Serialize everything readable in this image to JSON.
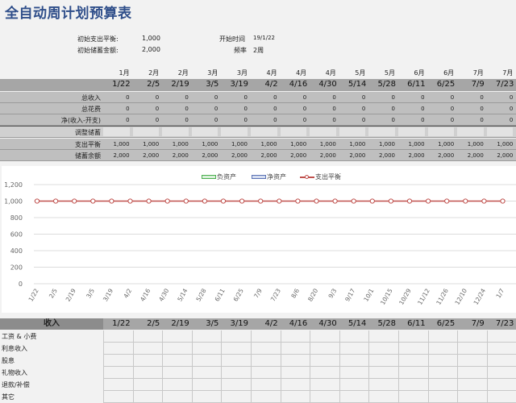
{
  "title": "全自动周计划预算表",
  "info": {
    "initial_spending_balance_label": "初始支出平衡:",
    "initial_spending_balance_value": "1,000",
    "initial_savings_label": "初始储蓄金额:",
    "initial_savings_value": "2,000",
    "start_time_label": "开始时间",
    "start_time_value": "19/1/22",
    "frequency_label": "频率",
    "frequency_value": "2周"
  },
  "columns": [
    {
      "month": "1月",
      "date": "1/22"
    },
    {
      "month": "2月",
      "date": "2/5"
    },
    {
      "month": "2月",
      "date": "2/19"
    },
    {
      "month": "3月",
      "date": "3/5"
    },
    {
      "month": "3月",
      "date": "3/19"
    },
    {
      "month": "4月",
      "date": "4/2"
    },
    {
      "month": "4月",
      "date": "4/16"
    },
    {
      "month": "4月",
      "date": "4/30"
    },
    {
      "month": "5月",
      "date": "5/14"
    },
    {
      "month": "5月",
      "date": "5/28"
    },
    {
      "month": "6月",
      "date": "6/11"
    },
    {
      "month": "6月",
      "date": "6/25"
    },
    {
      "month": "7月",
      "date": "7/9"
    },
    {
      "month": "7月",
      "date": "7/23"
    }
  ],
  "summary_rows": [
    {
      "label": "总收入",
      "values": [
        "0",
        "0",
        "0",
        "0",
        "0",
        "0",
        "0",
        "0",
        "0",
        "0",
        "0",
        "0",
        "0",
        "0"
      ]
    },
    {
      "label": "总花费",
      "values": [
        "0",
        "0",
        "0",
        "0",
        "0",
        "0",
        "0",
        "0",
        "0",
        "0",
        "0",
        "0",
        "0",
        "0"
      ]
    },
    {
      "label": "净(收入-开支)",
      "values": [
        "0",
        "0",
        "0",
        "0",
        "0",
        "0",
        "0",
        "0",
        "0",
        "0",
        "0",
        "0",
        "0",
        "0"
      ]
    },
    {
      "label": "调整储蓄",
      "values": [
        "",
        "",
        "",
        "",
        "",
        "",
        "",
        "",
        "",
        "",
        "",
        "",
        "",
        ""
      ]
    },
    {
      "label": "支出平衡",
      "values": [
        "1,000",
        "1,000",
        "1,000",
        "1,000",
        "1,000",
        "1,000",
        "1,000",
        "1,000",
        "1,000",
        "1,000",
        "1,000",
        "1,000",
        "1,000",
        "1,000"
      ]
    },
    {
      "label": "储蓄余额",
      "values": [
        "2,000",
        "2,000",
        "2,000",
        "2,000",
        "2,000",
        "2,000",
        "2,000",
        "2,000",
        "2,000",
        "2,000",
        "2,000",
        "2,000",
        "2,000",
        "2,000"
      ]
    }
  ],
  "colors": {
    "header_bg": "#a6a6a6",
    "row_bg": "#bfbfbf",
    "title": "#2f4e8a",
    "negative_assets": "#4caf50",
    "net_assets": "#5b73b5",
    "spending_balance": "#c0504d"
  },
  "chart_data": {
    "type": "line",
    "legend_position": "top-center",
    "grid": true,
    "ylim": [
      0,
      1200
    ],
    "yticks": [
      "0",
      "200",
      "400",
      "600",
      "800",
      "1,000",
      "1,200"
    ],
    "x": [
      "1/22",
      "2/5",
      "2/19",
      "3/5",
      "3/19",
      "4/2",
      "4/16",
      "4/30",
      "5/14",
      "5/28",
      "6/11",
      "6/25",
      "7/9",
      "7/23",
      "8/6",
      "8/20",
      "9/3",
      "9/17",
      "10/1",
      "10/15",
      "10/29",
      "11/12",
      "11/26",
      "12/10",
      "12/24",
      "1/7"
    ],
    "series": [
      {
        "name": "负资产",
        "kind": "area",
        "values": []
      },
      {
        "name": "净资产",
        "kind": "area",
        "values": []
      },
      {
        "name": "支出平衡",
        "kind": "line",
        "values": [
          1000,
          1000,
          1000,
          1000,
          1000,
          1000,
          1000,
          1000,
          1000,
          1000,
          1000,
          1000,
          1000,
          1000,
          1000,
          1000,
          1000,
          1000,
          1000,
          1000,
          1000,
          1000,
          1000,
          1000,
          1000,
          1000
        ]
      }
    ]
  },
  "income_section": {
    "header": "收入",
    "rows": [
      "工资 & 小费",
      "利息收入",
      "股息",
      "礼物收入",
      "退款/补偿",
      "其它"
    ]
  }
}
